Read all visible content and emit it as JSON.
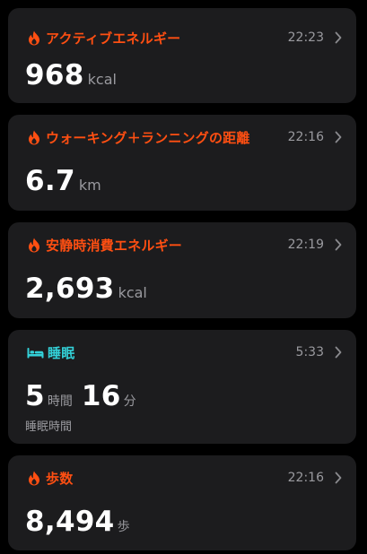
{
  "colors": {
    "activity": "#ff4f12",
    "sleep": "#33d1d8",
    "card_bg": "#1c1c1e",
    "secondary_text": "#9a9a9f"
  },
  "cards": [
    {
      "icon": "flame-icon",
      "title": "アクティブエネルギー",
      "time": "22:23",
      "value": "968",
      "unit": "kcal"
    },
    {
      "icon": "flame-icon",
      "title": "ウォーキング＋ランニングの距離",
      "time": "22:16",
      "value": "6.7",
      "unit": "km"
    },
    {
      "icon": "flame-icon",
      "title": "安静時消費エネルギー",
      "time": "22:19",
      "value": "2,693",
      "unit": "kcal"
    },
    {
      "icon": "bed-icon",
      "title": "睡眠",
      "time": "5:33",
      "hours": "5",
      "hours_unit": "時間",
      "minutes": "16",
      "minutes_unit": "分",
      "subtitle": "睡眠時間"
    },
    {
      "icon": "flame-icon",
      "title": "歩数",
      "time": "22:16",
      "value": "8,494",
      "unit": "歩"
    }
  ]
}
